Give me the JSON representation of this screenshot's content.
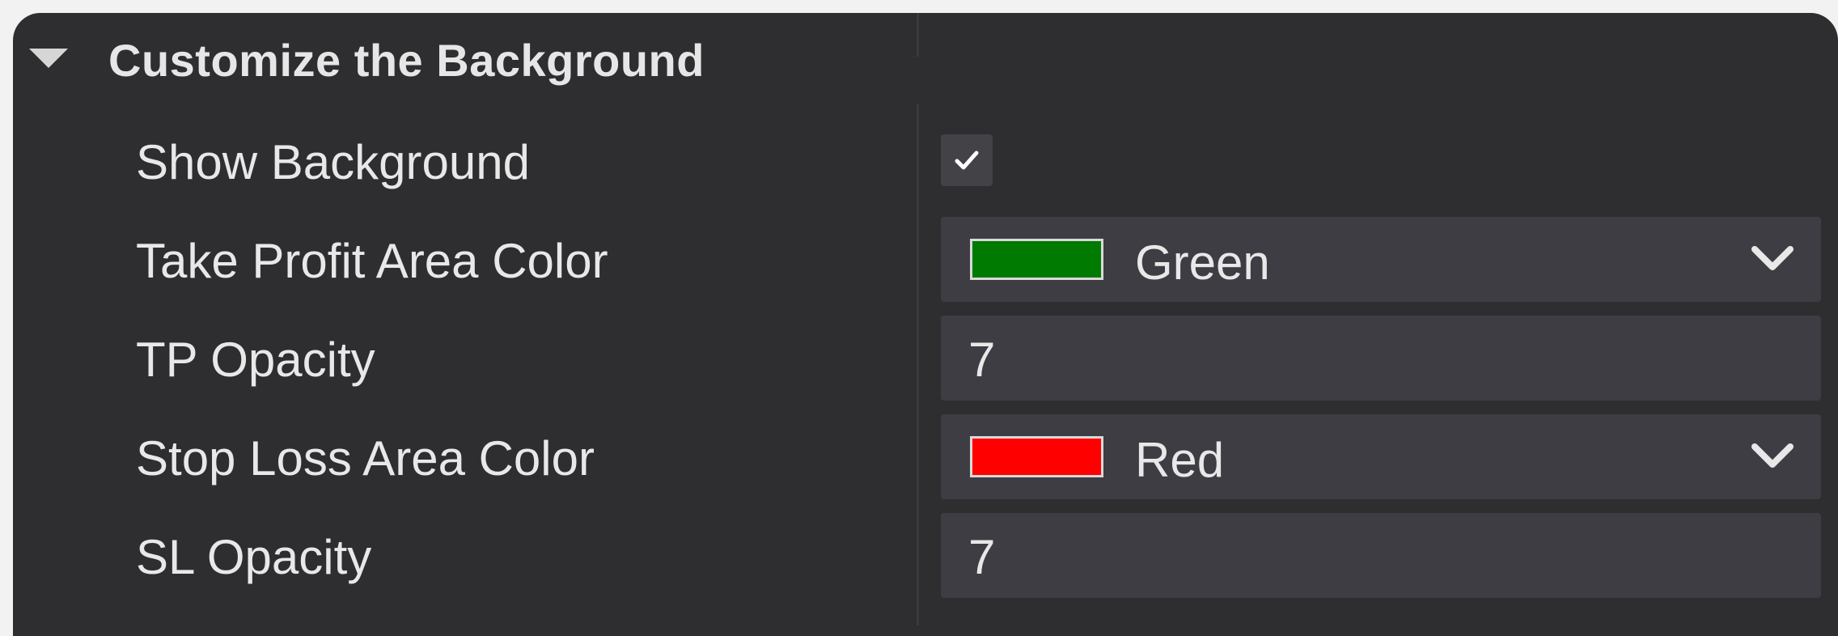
{
  "section": {
    "title": "Customize the Background"
  },
  "rows": {
    "show_background": {
      "label": "Show Background",
      "checked": true
    },
    "tp_color": {
      "label": "Take Profit Area Color",
      "value": "Green",
      "swatch": "#007a00"
    },
    "tp_opacity": {
      "label": "TP Opacity",
      "value": "7"
    },
    "sl_color": {
      "label": "Stop Loss Area Color",
      "value": "Red",
      "swatch": "#ff0000"
    },
    "sl_opacity": {
      "label": "SL Opacity",
      "value": "7"
    }
  },
  "icons": {
    "collapse": "triangle-down-icon",
    "check": "check-icon",
    "dropdown": "chevron-down-icon"
  },
  "colors": {
    "panel_bg": "#2e2e31",
    "field_bg": "#3d3d43",
    "text": "#e8e8e8"
  }
}
